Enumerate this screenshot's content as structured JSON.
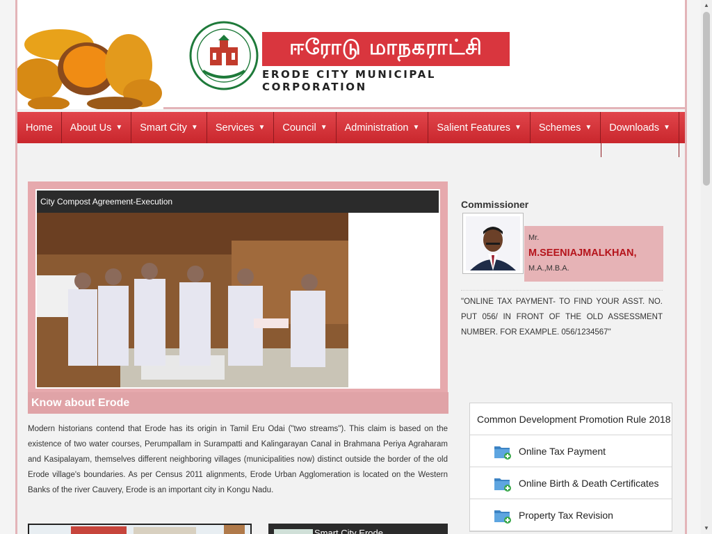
{
  "header": {
    "tamil_title": "ஈரோடு மாநகராட்சி",
    "english_title": "ERODE CITY MUNICIPAL CORPORATION"
  },
  "nav": {
    "items": [
      {
        "label": "Home"
      },
      {
        "label": "About Us"
      },
      {
        "label": "Smart City"
      },
      {
        "label": "Services"
      },
      {
        "label": "Council"
      },
      {
        "label": "Administration"
      },
      {
        "label": "Salient Features"
      },
      {
        "label": "Schemes"
      },
      {
        "label": "Downloads"
      }
    ]
  },
  "slider": {
    "caption": "City Compost Agreement-Execution"
  },
  "about": {
    "heading": "Know about Erode",
    "text": "Modern historians contend that Erode has its origin in Tamil Eru Odai (\"two streams\"). This claim is based on the existence of two water courses, Perumpallam in Surampatti and Kalingarayan Canal in Brahmana Periya Agraharam and Kasipalayam, themselves different neighboring villages (municipalities now) distinct outside the border of the old Erode village's boundaries. As per Census 2011 alignments, Erode Urban Agglomeration is located on the Western Banks of the river Cauvery, Erode is an important city in Kongu Nadu."
  },
  "bottom": {
    "thumb2_label": "Smart City Erode"
  },
  "commissioner": {
    "title": "Commissioner",
    "prefix": "Mr.",
    "name": "M.SEENIAJMALKHAN,",
    "qualification": "M.A.,M.B.A."
  },
  "notice": "\"ONLINE TAX PAYMENT- TO FIND YOUR ASST. NO. PUT 056/ IN FRONT OF THE OLD ASSESSMENT NUMBER. FOR EXAMPLE. 056/1234567\"",
  "quick_links": {
    "header": "Common Development Promotion Rule 2018",
    "items": [
      {
        "label": "Online Tax Payment",
        "icon": "folder-add-icon"
      },
      {
        "label": "Online Birth & Death Certificates",
        "icon": "folder-add-icon"
      },
      {
        "label": "Property Tax Revision",
        "icon": "folder-add-icon"
      }
    ]
  },
  "colors": {
    "nav_red": "#d9363e",
    "border_pink": "#e3b4b8",
    "accent_name": "#b5141b"
  }
}
